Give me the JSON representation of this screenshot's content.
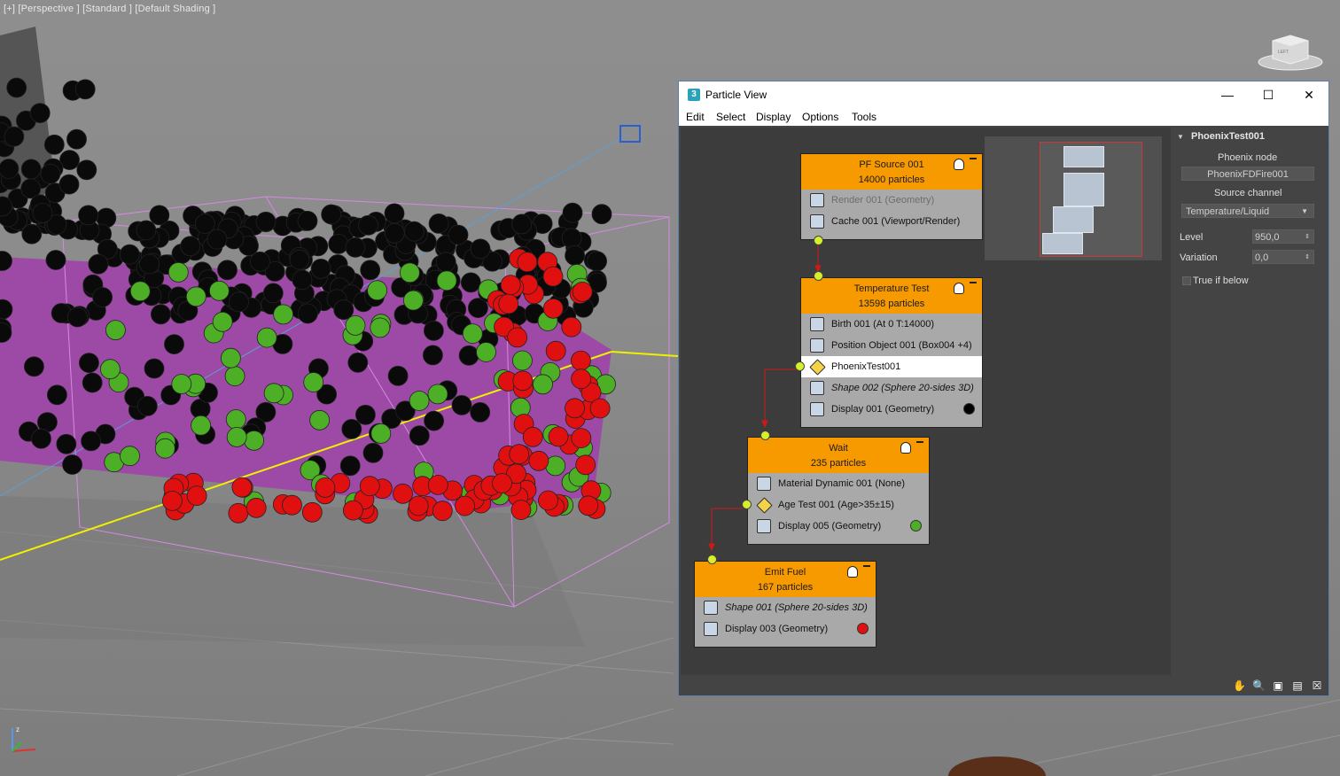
{
  "viewport": {
    "label": "[+] [Perspective ] [Standard ] [Default Shading ]",
    "viewcube_label": "LEFT"
  },
  "window": {
    "title": "Particle View",
    "app_icon": "3",
    "minimize_icon": "minimize-icon",
    "maximize_icon": "maximize-icon",
    "close_icon": "close-icon"
  },
  "menu": [
    "Edit",
    "Select",
    "Display",
    "Options",
    "Tools"
  ],
  "events": [
    {
      "title": "PF Source 001",
      "count": "14000 particles",
      "operators": [
        {
          "label": "Render 001 (Geometry)",
          "dim": true
        },
        {
          "label": "Cache 001 (Viewport/Render)"
        }
      ]
    },
    {
      "title": "Temperature Test",
      "count": "13598 particles",
      "operators": [
        {
          "label": "Birth 001 (At 0 T:14000)"
        },
        {
          "label": "Position Object 001 (Box004 +4)"
        },
        {
          "label": "PhoenixTest001",
          "selected": true,
          "test": true
        },
        {
          "label": "Shape 002 (Sphere 20-sides 3D)",
          "italic": true
        },
        {
          "label": "Display 001 (Geometry)",
          "swatch": "#000000"
        }
      ]
    },
    {
      "title": "Wait",
      "count": "235 particles",
      "operators": [
        {
          "label": "Material Dynamic 001 (None)"
        },
        {
          "label": "Age Test 001 (Age>35±15)",
          "test": true
        },
        {
          "label": "Display 005 (Geometry)",
          "swatch": "#4caf25"
        }
      ]
    },
    {
      "title": "Emit Fuel",
      "count": "167 particles",
      "operators": [
        {
          "label": "Shape 001 (Sphere 20-sides 3D)",
          "italic": true
        },
        {
          "label": "Display 003 (Geometry)",
          "swatch": "#e01010"
        }
      ]
    }
  ],
  "properties": {
    "header": "PhoenixTest001",
    "phoenix_node_label": "Phoenix node",
    "phoenix_node_value": "PhoenixFDFire001",
    "source_channel_label": "Source channel",
    "source_channel_value": "Temperature/Liquid",
    "level_label": "Level",
    "level_value": "950,0",
    "variation_label": "Variation",
    "variation_value": "0,0",
    "true_if_below_label": "True if below",
    "true_if_below_checked": false
  },
  "colors": {
    "event_header": "#f79a00",
    "port": "#d7ef2b",
    "wire": "#d01818",
    "purple_volume": "#9d4aa6",
    "particle_green": "#4caf25",
    "particle_red": "#e01010",
    "particle_black": "#0a0a0a"
  }
}
